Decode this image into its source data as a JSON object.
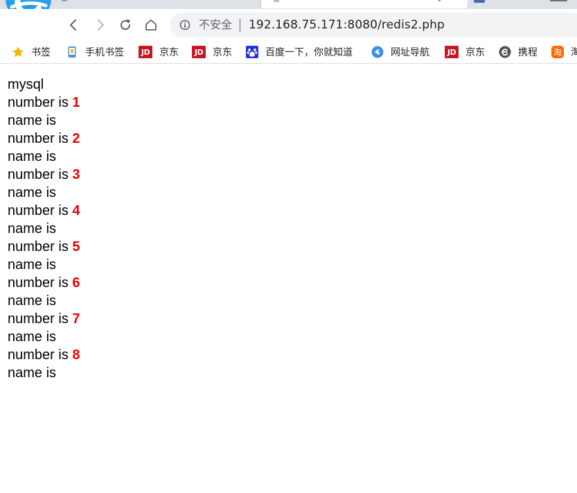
{
  "browser": {
    "nav": {
      "back_icon": "chevron-left-icon",
      "forward_icon": "chevron-right-icon",
      "reload_icon": "reload-icon",
      "home_icon": "home-icon"
    },
    "address_bar": {
      "info_icon": "info-circle-icon",
      "security_label": "不安全",
      "url": "192.168.75.171:8080/redis2.php"
    },
    "bookmarks": [
      {
        "label": "书签",
        "icon": "star-icon"
      },
      {
        "label": "手机书签",
        "icon": "phone-icon"
      },
      {
        "label": "京东",
        "icon": "jd-icon"
      },
      {
        "label": "京东",
        "icon": "jd-icon"
      },
      {
        "label": "百度一下，你就知道",
        "icon": "baidu-paw-icon"
      },
      {
        "label": "网址导航",
        "icon": "web-nav-icon"
      },
      {
        "label": "京东",
        "icon": "jd-icon"
      },
      {
        "label": "携程",
        "icon": "ctrip-icon"
      },
      {
        "label": "淘",
        "icon": "taobao-icon"
      }
    ],
    "jd_icon_text": "JD"
  },
  "page": {
    "heading": "mysql",
    "number_prefix": "number is",
    "name_label": "name is",
    "records": [
      {
        "number": "1"
      },
      {
        "number": "2"
      },
      {
        "number": "3"
      },
      {
        "number": "4"
      },
      {
        "number": "5"
      },
      {
        "number": "6"
      },
      {
        "number": "7"
      },
      {
        "number": "8"
      }
    ]
  },
  "colors": {
    "number_highlight": "#ee0000",
    "jd_red": "#c91623",
    "address_bar_bg": "#f1f3f4",
    "tabstrip_bg": "#dee1e6"
  }
}
